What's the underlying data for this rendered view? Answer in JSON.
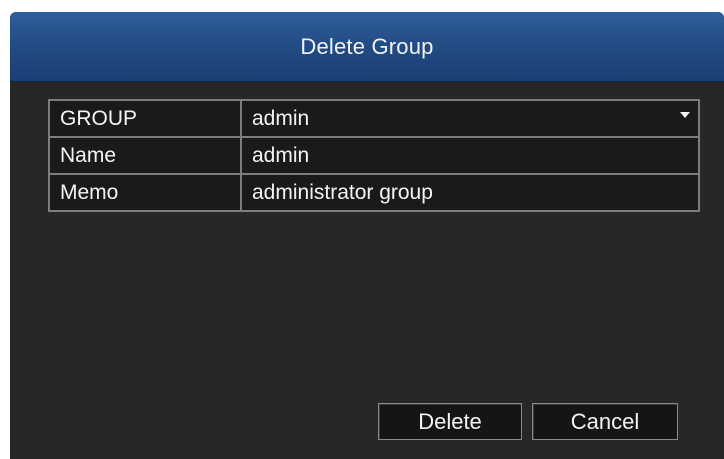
{
  "dialog": {
    "title": "Delete Group"
  },
  "form": {
    "rows": [
      {
        "label": "GROUP",
        "value": "admin",
        "control": "dropdown"
      },
      {
        "label": "Name",
        "value": "admin",
        "control": "text"
      },
      {
        "label": "Memo",
        "value": "administrator group",
        "control": "text"
      }
    ]
  },
  "buttons": {
    "delete_label": "Delete",
    "cancel_label": "Cancel"
  },
  "icons": {
    "dropdown": "chevron-down-icon"
  },
  "colors": {
    "titlebar": "#234d86",
    "background": "#272727",
    "text": "#f4f4f4",
    "border": "#7d7d7d"
  }
}
